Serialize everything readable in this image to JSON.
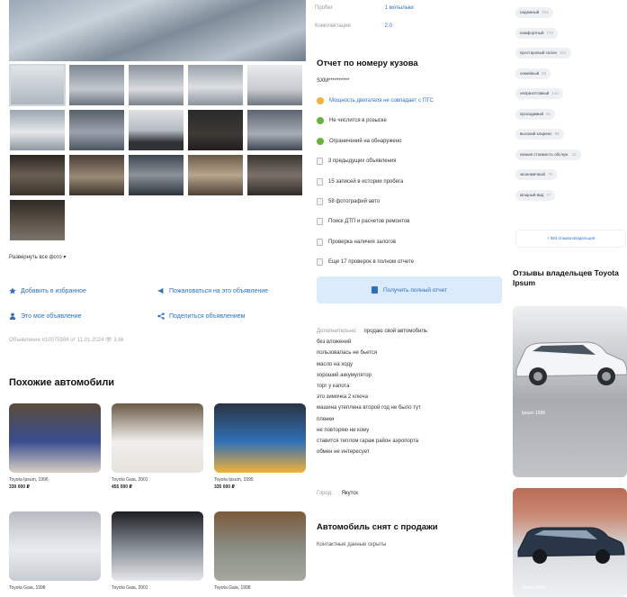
{
  "details": [
    {
      "label": "Пробег",
      "value": "1 мотыльки"
    },
    {
      "label": "Комплектация",
      "value": "2.0"
    }
  ],
  "expand_link": "Развернуть все фото ▾",
  "actions": {
    "add_to_favorites": "Добавить в избранное",
    "complain": "Пожаловаться на это объявление",
    "my_ads": "Это мое объявление",
    "share": "Поделиться объявлением"
  },
  "meta_line": "Объявление #10075994 от 11.01.2024   👁 3.6k",
  "similar": {
    "title": "Похожие автомобили",
    "cars": [
      {
        "name": "Toyota Ipsum, 1996",
        "price": "330 000 ₽",
        "c1": "#5a4b3c",
        "c2": "#3a4d8f",
        "c3": "#d8cfc4"
      },
      {
        "name": "Toyota Gaia, 2001",
        "price": "455 000 ₽",
        "c1": "#6b5a47",
        "c2": "#f0efec",
        "c3": "#e6e3dd"
      },
      {
        "name": "Toyota Ipsum, 1995",
        "price": "335 000 ₽",
        "c1": "#2b3442",
        "c2": "#2f6fb5",
        "c3": "#f0b23a"
      },
      {
        "name": "Toyota Gaia, 1998",
        "price": "",
        "c1": "#b8bcc2",
        "c2": "#e9ecef",
        "c3": "#c8ccd2"
      },
      {
        "name": "Toyota Gaia, 2001",
        "price": "",
        "c1": "#1d1f24",
        "c2": "#8e949c",
        "c3": "#e5e7ea"
      },
      {
        "name": "Toyota Gaia, 1998",
        "price": "",
        "c1": "#7a5a3c",
        "c2": "#8b8f86",
        "c3": "#a7a99f"
      }
    ]
  },
  "report": {
    "title": "Отчет по номеру кузова",
    "code": "SXM**********",
    "checks": [
      {
        "text": "Мощность двигателя не совпадает с ПТС",
        "status": "warn",
        "link": true
      },
      {
        "text": "Не числится в розыске",
        "status": "ok",
        "link": false
      },
      {
        "text": "Ограничений на обнаружено",
        "status": "ok",
        "link": false
      },
      {
        "text": "3 предыдущих объявления",
        "status": "box",
        "link": false
      },
      {
        "text": "15 записей в истории пробега",
        "status": "box",
        "link": false
      },
      {
        "text": "58 фотографий авто",
        "status": "box",
        "link": false
      },
      {
        "text": "Поиск ДТП и расчетов ремонтов",
        "status": "box",
        "link": false
      },
      {
        "text": "Проверка наличия залогов",
        "status": "box",
        "link": false
      },
      {
        "text": "Еще 17 проверок в полном отчете",
        "status": "box",
        "link": false
      }
    ],
    "button": "Получить полный отчет"
  },
  "description": {
    "label": "Дополнительно:",
    "lines": [
      "продаю свой автомобиль",
      "без вложений",
      "пользовалась не бьется",
      "масло на ходу",
      "хороший аккумулятор",
      "торг у капота",
      "это зимочка 2 ключа",
      "машина утеплена второй год не было тут",
      "пленки",
      "не повторяю ни кому",
      "ставится теплом гараж район аэропорта",
      "обмен не интересует"
    ]
  },
  "city": {
    "label": "Город:",
    "value": "Якутск"
  },
  "removed": {
    "title": "Автомобиль снят с продажи",
    "subtitle": "Контактные данные скрыты"
  },
  "tags": [
    {
      "text": "надежный",
      "count": "161"
    },
    {
      "text": "комфортный",
      "count": "170"
    },
    {
      "text": "простаровый салон",
      "count": "151"
    },
    {
      "text": "семейный",
      "count": "93"
    },
    {
      "text": "неприхотливый",
      "count": "143"
    },
    {
      "text": "проходимый",
      "count": "91"
    },
    {
      "text": "высокий клиренс",
      "count": "98"
    },
    {
      "text": "низкая стоимость обслуж.",
      "count": "32"
    },
    {
      "text": "экономичный",
      "count": "75"
    },
    {
      "text": "мощный вид",
      "count": "17"
    }
  ],
  "all_reviews": "+ 584 отзыва владельцев",
  "owners": {
    "title": "Отзывы владельцев Toyota Ipsum",
    "cards": [
      {
        "caption": "Ipsum 1996"
      },
      {
        "caption": "Ipsum 1999"
      }
    ]
  },
  "colors": {
    "accent": "#2a70c8",
    "ok": "#64b63a",
    "warn": "#f0b23a",
    "button_bg": "#dcebfa"
  }
}
